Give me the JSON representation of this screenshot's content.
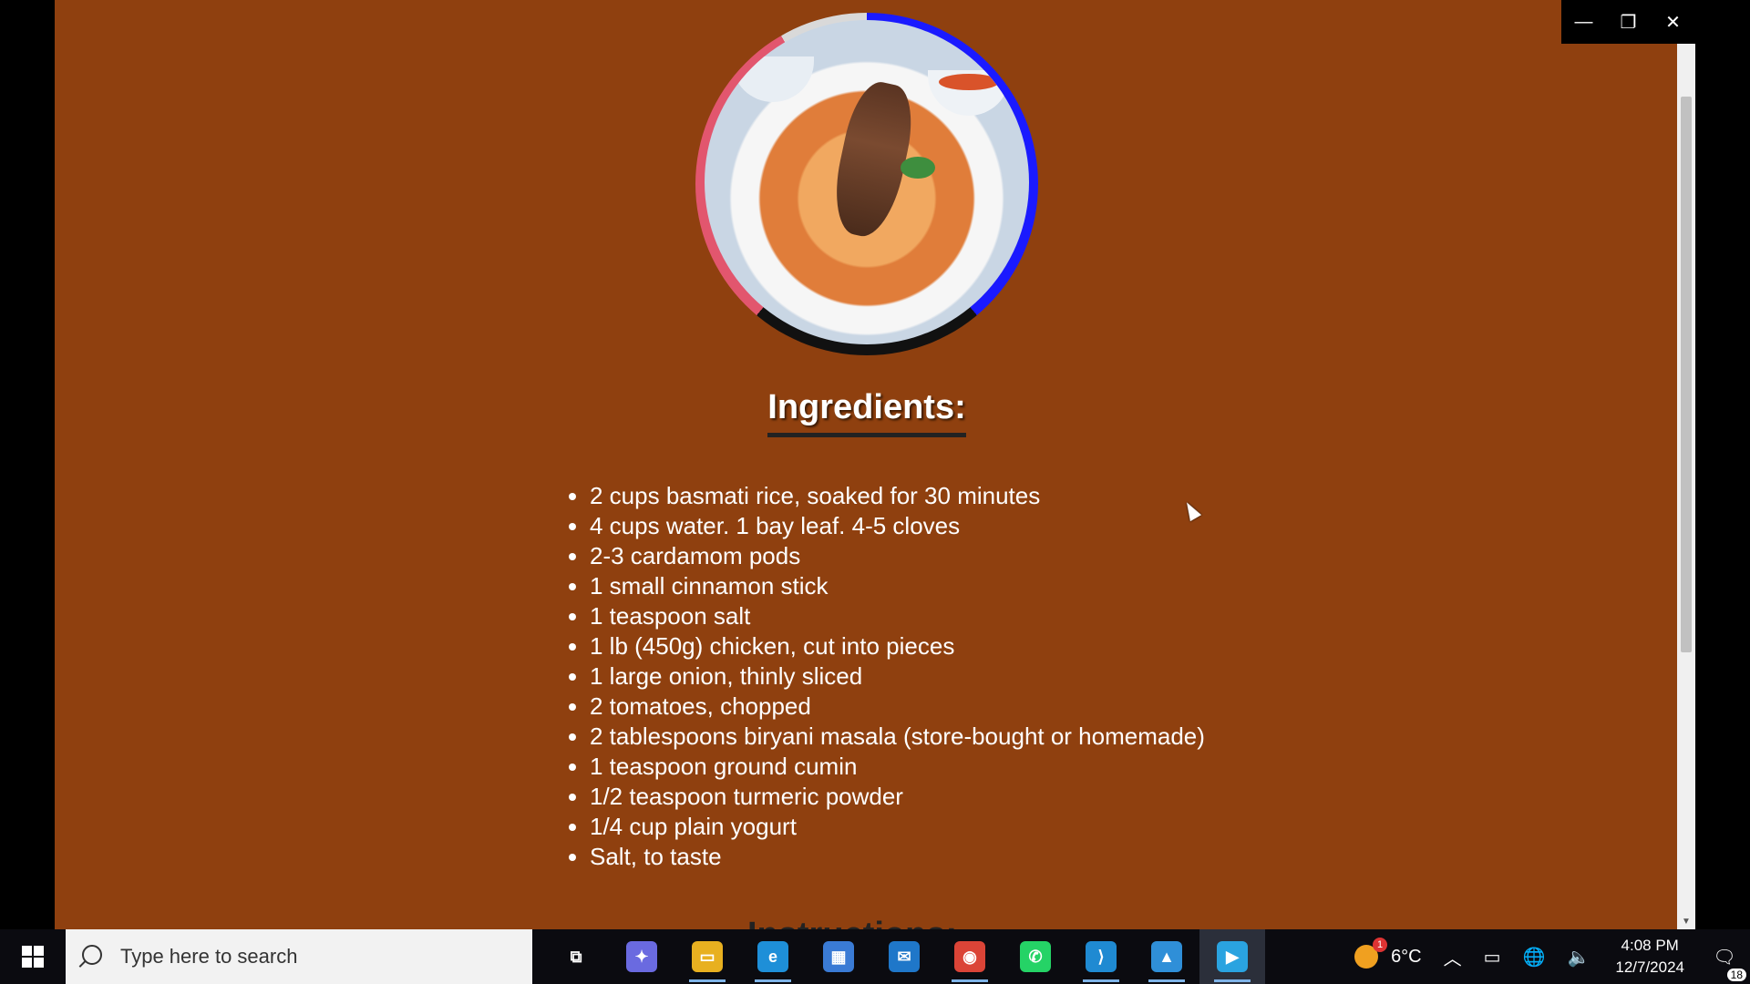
{
  "page": {
    "heading": "Ingredients:",
    "ingredients": [
      "2 cups basmati rice, soaked for 30 minutes",
      "4 cups water. 1 bay leaf. 4-5 cloves",
      "2-3 cardamom pods",
      "1 small cinnamon stick",
      "1 teaspoon salt",
      "1 lb (450g) chicken, cut into pieces",
      "1 large onion, thinly sliced",
      "2 tomatoes, chopped",
      "2 tablespoons biryani masala (store-bought or homemade)",
      "1 teaspoon ground cumin",
      "1/2 teaspoon turmeric powder",
      "1/4 cup plain yogurt",
      "Salt, to taste"
    ],
    "next_heading": "Instructions:",
    "background_color": "#8f400f"
  },
  "window": {
    "minimize": "—",
    "restore": "❐",
    "close": "✕"
  },
  "taskbar": {
    "search_placeholder": "Type here to search",
    "apps": [
      {
        "name": "task-view",
        "glyph": "⧉",
        "color": "transparent"
      },
      {
        "name": "copilot",
        "glyph": "✦",
        "color": "#6a6ae0"
      },
      {
        "name": "file-explorer",
        "glyph": "▭",
        "color": "#e8b020"
      },
      {
        "name": "edge",
        "glyph": "e",
        "color": "#1e8fd8"
      },
      {
        "name": "microsoft-store",
        "glyph": "▦",
        "color": "#3a7bd5"
      },
      {
        "name": "mail",
        "glyph": "✉",
        "color": "#1f77c9"
      },
      {
        "name": "chrome",
        "glyph": "◉",
        "color": "#db4437"
      },
      {
        "name": "whatsapp",
        "glyph": "✆",
        "color": "#25d366"
      },
      {
        "name": "vscode",
        "glyph": "⟩",
        "color": "#1f8ad2"
      },
      {
        "name": "photos",
        "glyph": "▲",
        "color": "#2f8fd8"
      },
      {
        "name": "media-player",
        "glyph": "▶",
        "color": "#2aa3e0"
      }
    ],
    "weather": {
      "temp": "6°C",
      "badge": "1"
    },
    "time": "4:08 PM",
    "date": "12/7/2024",
    "notifications": "18"
  }
}
